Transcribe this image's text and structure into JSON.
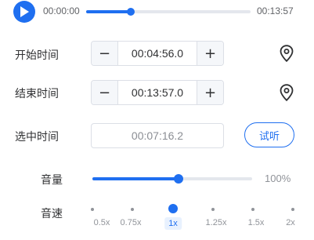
{
  "player": {
    "current_time": "00:00:00",
    "total_time": "00:13:57",
    "progress_fraction": 0.27
  },
  "start": {
    "label": "开始时间",
    "value": "00:04:56.0",
    "minus": "−",
    "plus": "+"
  },
  "end": {
    "label": "结束时间",
    "value": "00:13:57.0",
    "minus": "−",
    "plus": "+"
  },
  "selected": {
    "label": "选中时间",
    "value": "00:07:16.2",
    "listen_label": "试听"
  },
  "volume": {
    "label": "音量",
    "value_text": "100%",
    "level_fraction": 0.54
  },
  "speed": {
    "label": "音速",
    "options": [
      "0.5x",
      "0.75x",
      "1x",
      "1.25x",
      "1.5x",
      "2x"
    ],
    "selected_index": 2
  },
  "colors": {
    "accent": "#1f6ff0",
    "track": "#e4e7ed",
    "border": "#dcdfe6"
  }
}
